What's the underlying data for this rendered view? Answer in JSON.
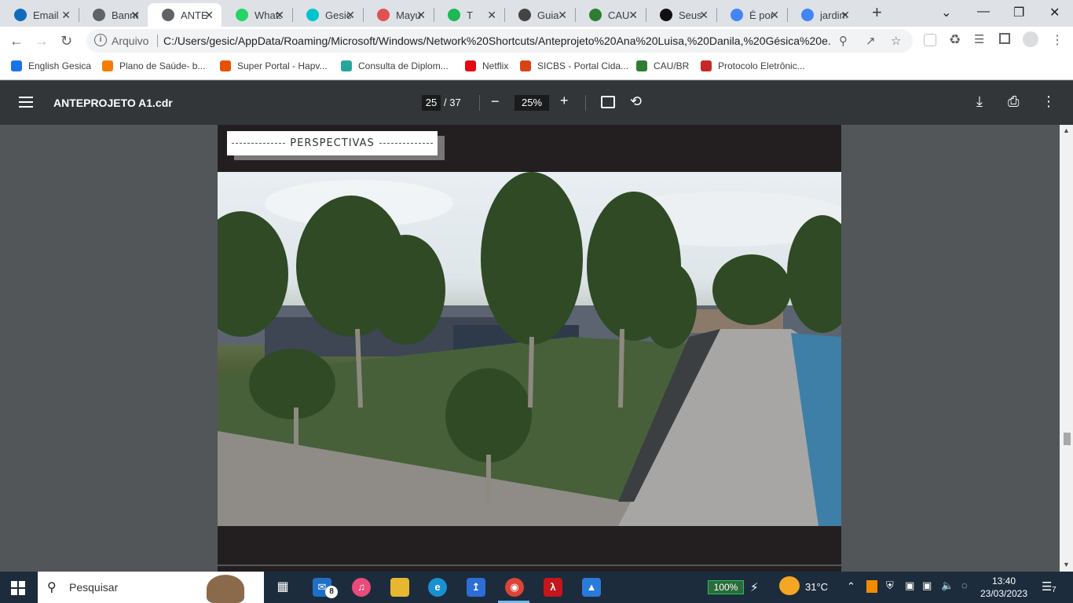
{
  "browser": {
    "tabs": [
      {
        "title": "Email",
        "icon": "outlook-icon",
        "color": "#0f6cbd"
      },
      {
        "title": "Banner",
        "icon": "globe-icon",
        "color": "#5f6368"
      },
      {
        "title": "ANTEPROJETO",
        "icon": "globe-icon",
        "color": "#5f6368",
        "active": true
      },
      {
        "title": "WhatsApp",
        "icon": "whatsapp-icon",
        "color": "#25d366"
      },
      {
        "title": "Gesica",
        "icon": "canva-icon",
        "color": "#00c4cc"
      },
      {
        "title": "Mayu",
        "icon": "target-icon",
        "color": "#e05252"
      },
      {
        "title": "T",
        "icon": "spotify-icon",
        "color": "#1db954"
      },
      {
        "title": "Guia",
        "icon": "m-icon",
        "color": "#444444"
      },
      {
        "title": "CAU",
        "icon": "cau-icon",
        "color": "#2e7d32"
      },
      {
        "title": "Seus",
        "icon": "amazon-icon",
        "color": "#111111"
      },
      {
        "title": "É por",
        "icon": "google-icon",
        "color": "#4285f4"
      },
      {
        "title": "jardim",
        "icon": "google-icon",
        "color": "#4285f4"
      }
    ],
    "new_tab": "+",
    "address": {
      "scheme_label": "Arquivo",
      "url": "C:/Users/gesic/AppData/Roaming/Microsoft/Windows/Network%20Shortcuts/Anteprojeto%20Ana%20Luisa,%20Danila,%20Gésica%20e..."
    },
    "bookmarks": [
      {
        "label": "English Gesica",
        "icon": "person-icon",
        "color": "#1a73e8"
      },
      {
        "label": "Plano de Saúde- b...",
        "icon": "flower-icon",
        "color": "#f57c00"
      },
      {
        "label": "Super Portal - Hapv...",
        "icon": "flower-icon",
        "color": "#e65100"
      },
      {
        "label": "Consulta de Diplom...",
        "icon": "diamond-icon",
        "color": "#26a69a"
      },
      {
        "label": "Netflix",
        "icon": "netflix-icon",
        "color": "#e50914"
      },
      {
        "label": "SICBS - Portal Cida...",
        "icon": "x-icon",
        "color": "#d84315"
      },
      {
        "label": "CAU/BR",
        "icon": "cau-icon",
        "color": "#2e7d32"
      },
      {
        "label": "Protocolo Eletrônic...",
        "icon": "dots-icon",
        "color": "#c62828"
      }
    ]
  },
  "pdf": {
    "filename": "ANTEPROJETO A1.cdr",
    "page_current": "25",
    "page_total": "/ 37",
    "zoom": "25%",
    "page_header": "PERSPECTIVAS"
  },
  "taskbar": {
    "search_placeholder": "Pesquisar",
    "mail_badge": "8",
    "battery": "100%",
    "temperature": "31°C",
    "time": "13:40",
    "date": "23/03/2023",
    "notifications": "7"
  }
}
